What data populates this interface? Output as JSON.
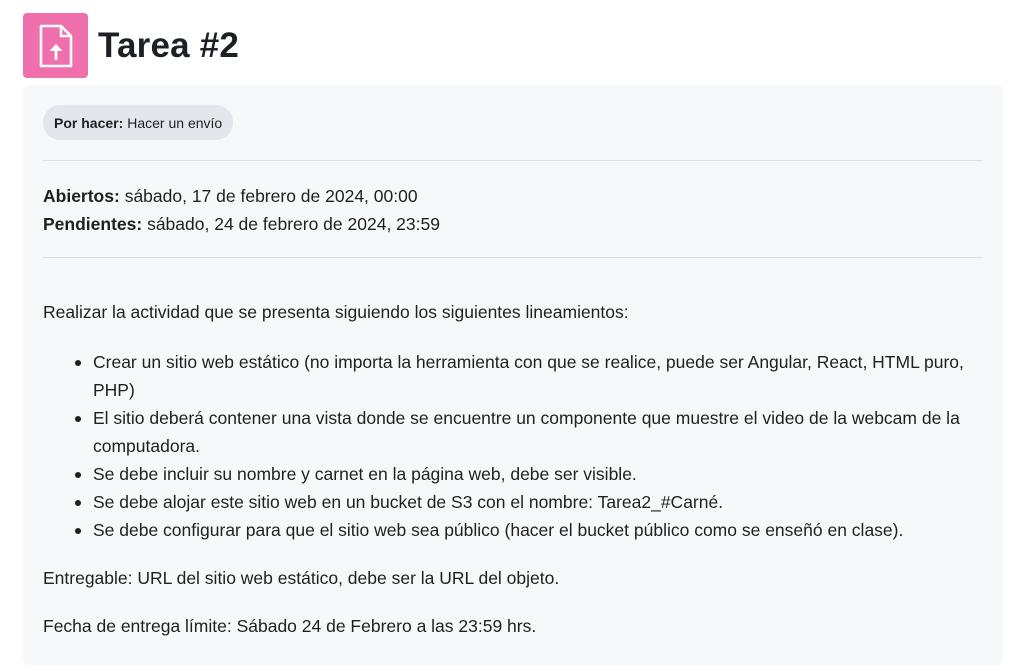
{
  "header": {
    "icon": "assignment-upload-icon",
    "icon_color": "#f06fad",
    "title": "Tarea #2"
  },
  "status": {
    "label": "Por hacer:",
    "value": "Hacer un envío"
  },
  "dates": {
    "opened_label": "Abiertos:",
    "opened_value": "sábado, 17 de febrero de 2024, 00:00",
    "due_label": "Pendientes:",
    "due_value": "sábado, 24 de febrero de 2024, 23:59"
  },
  "description": {
    "intro": "Realizar la actividad que se presenta siguiendo los siguientes lineamientos:",
    "items": [
      "Crear un sitio web estático (no importa la herramienta con que se realice, puede ser Angular, React, HTML puro, PHP)",
      "El sitio deberá contener una vista donde se encuentre un componente que muestre el video de la webcam de la computadora.",
      "Se debe incluir su nombre y carnet en la página web, debe ser visible.",
      "Se debe alojar este sitio web en un bucket de S3 con el nombre: Tarea2_#Carné.",
      "Se debe configurar para que el sitio web sea público (hacer el bucket público como se enseñó en clase)."
    ],
    "deliverable": "Entregable: URL del sitio web estático, debe ser la URL del objeto.",
    "deadline": "Fecha de entrega límite: Sábado 24 de Febrero a las 23:59 hrs."
  }
}
